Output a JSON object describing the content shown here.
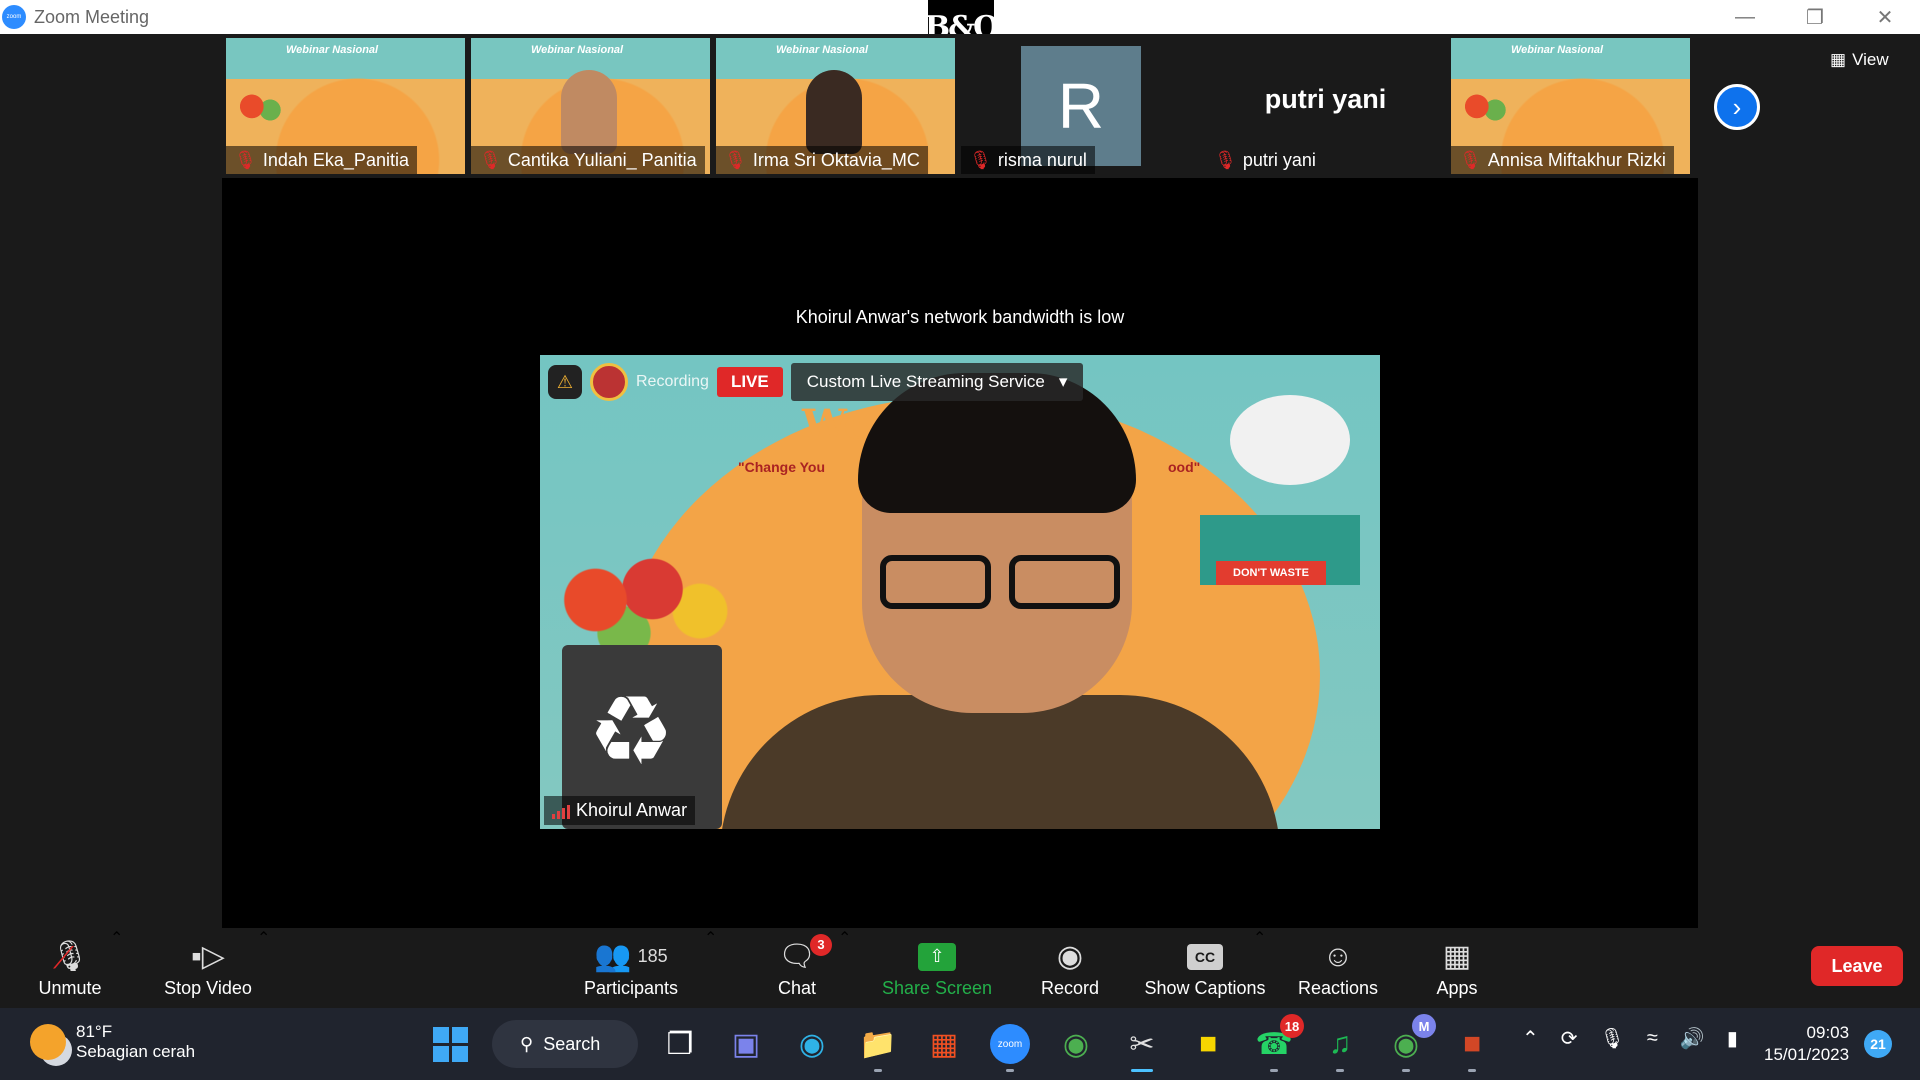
{
  "window": {
    "title": "Zoom Meeting",
    "overlay_logo": "B&O"
  },
  "thumbnails": [
    {
      "name": "Indah Eka_Panitia",
      "type": "video",
      "banner": "Webinar Nasional"
    },
    {
      "name": "Cantika Yuliani_ Panitia",
      "type": "video",
      "banner": "Webinar Nasional"
    },
    {
      "name": "Irma Sri Oktavia_MC",
      "type": "video",
      "banner": "Webinar Nasional"
    },
    {
      "name": "risma nurul",
      "type": "avatar",
      "initial": "R"
    },
    {
      "name": "putri yani",
      "type": "name-only",
      "display": "putri yani"
    },
    {
      "name": "Annisa Miftakhur Rizki",
      "type": "video",
      "banner": "Webinar Nasional"
    }
  ],
  "view_button": {
    "label": "View"
  },
  "notice": "Khoirul Anwar's network bandwidth is low",
  "main_video": {
    "speaker": "Khoirul Anwar",
    "recording_label": "Recording",
    "live_label": "LIVE",
    "stream_service": "Custom Live Streaming Service",
    "background_texts": {
      "headline": "We",
      "tagline": "\"Change You",
      "tagline_end": "ood\"",
      "dont_waste": "DON'T WASTE"
    }
  },
  "toolbar": {
    "unmute": "Unmute",
    "stop_video": "Stop Video",
    "participants": "Participants",
    "participants_count": "185",
    "chat": "Chat",
    "chat_badge": "3",
    "share_screen": "Share Screen",
    "record": "Record",
    "show_captions": "Show Captions",
    "cc": "CC",
    "reactions": "Reactions",
    "apps": "Apps",
    "leave": "Leave"
  },
  "taskbar": {
    "weather_temp": "81°F",
    "weather_condition": "Sebagian cerah",
    "search_label": "Search",
    "zoom_app_label": "zoom",
    "whatsapp_badge": "18",
    "chrome_profile_badge": "M",
    "time": "09:03",
    "date": "15/01/2023",
    "notification_count": "21"
  },
  "colors": {
    "accent_blue": "#0e72ed",
    "leave_red": "#e02828",
    "share_green": "#23a33a",
    "taskbar_bg": "#20242e",
    "zoom_bg": "#1a1a1a"
  }
}
